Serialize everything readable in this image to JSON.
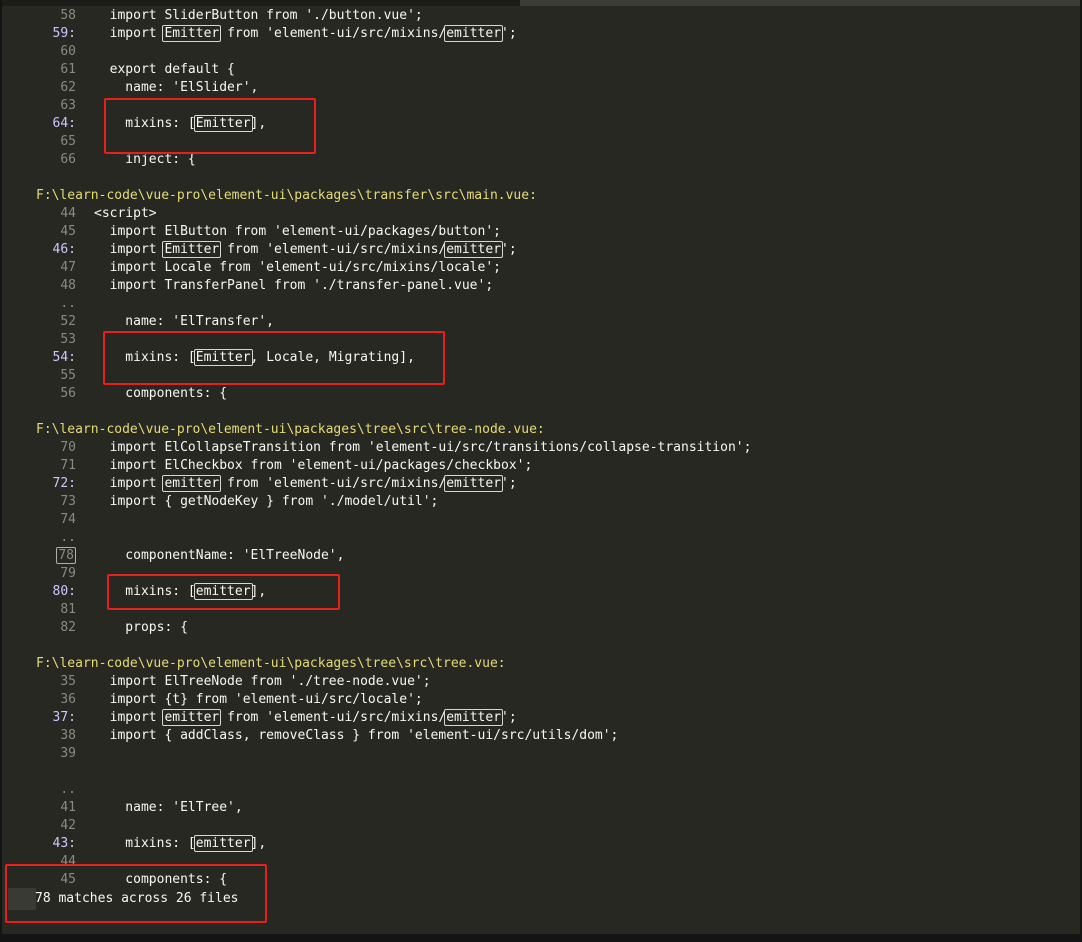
{
  "status": {
    "message": "78 matches across 26 files"
  },
  "colors": {
    "background": "#272822",
    "path": "#e6db74",
    "lineNumber": "#8a8a80",
    "matchLineNumber": "#ccc8ff",
    "annotation": "#e8201c"
  },
  "rows": [
    {
      "type": "line",
      "num": "58",
      "match": false,
      "code": [
        [
          "  import SliderButton from './button.vue';",
          false
        ]
      ]
    },
    {
      "type": "line",
      "num": "59:",
      "match": true,
      "code": [
        [
          "  import ",
          false
        ],
        [
          "Emitter",
          true
        ],
        [
          " from 'element-ui/src/mixins/",
          false
        ],
        [
          "emitter",
          true
        ],
        [
          "';",
          false
        ]
      ]
    },
    {
      "type": "line",
      "num": "60",
      "match": false,
      "code": []
    },
    {
      "type": "line",
      "num": "61",
      "match": false,
      "code": [
        [
          "  export default {",
          false
        ]
      ]
    },
    {
      "type": "line",
      "num": "62",
      "match": false,
      "code": [
        [
          "    name: 'ElSlider',",
          false
        ]
      ]
    },
    {
      "type": "line",
      "num": "63",
      "match": false,
      "code": []
    },
    {
      "type": "line",
      "num": "64:",
      "match": true,
      "code": [
        [
          "    mixins: [",
          false
        ],
        [
          "Emitter",
          true
        ],
        [
          "],",
          false
        ]
      ]
    },
    {
      "type": "line",
      "num": "65",
      "match": false,
      "code": []
    },
    {
      "type": "line",
      "num": "66",
      "match": false,
      "code": [
        [
          "    inject: {",
          false
        ]
      ]
    },
    {
      "type": "blank"
    },
    {
      "type": "path",
      "text": "F:\\learn-code\\vue-pro\\element-ui\\packages\\transfer\\src\\main.vue:"
    },
    {
      "type": "line",
      "num": "44",
      "match": false,
      "code": [
        [
          "<script>",
          false
        ]
      ]
    },
    {
      "type": "line",
      "num": "45",
      "match": false,
      "code": [
        [
          "  import ElButton from 'element-ui/packages/button';",
          false
        ]
      ]
    },
    {
      "type": "line",
      "num": "46:",
      "match": true,
      "code": [
        [
          "  import ",
          false
        ],
        [
          "Emitter",
          true
        ],
        [
          " from 'element-ui/src/mixins/",
          false
        ],
        [
          "emitter",
          true
        ],
        [
          "';",
          false
        ]
      ]
    },
    {
      "type": "line",
      "num": "47",
      "match": false,
      "code": [
        [
          "  import Locale from 'element-ui/src/mixins/locale';",
          false
        ]
      ]
    },
    {
      "type": "line",
      "num": "48",
      "match": false,
      "code": [
        [
          "  import TransferPanel from './transfer-panel.vue';",
          false
        ]
      ]
    },
    {
      "type": "line",
      "num": "..",
      "match": false,
      "code": []
    },
    {
      "type": "line",
      "num": "52",
      "match": false,
      "code": [
        [
          "    name: 'ElTransfer',",
          false
        ]
      ]
    },
    {
      "type": "line",
      "num": "53",
      "match": false,
      "code": []
    },
    {
      "type": "line",
      "num": "54:",
      "match": true,
      "code": [
        [
          "    mixins: [",
          false
        ],
        [
          "Emitter",
          true
        ],
        [
          ", Locale, Migrating],",
          false
        ]
      ]
    },
    {
      "type": "line",
      "num": "55",
      "match": false,
      "code": []
    },
    {
      "type": "line",
      "num": "56",
      "match": false,
      "code": [
        [
          "    components: {",
          false
        ]
      ]
    },
    {
      "type": "blank"
    },
    {
      "type": "path",
      "text": "F:\\learn-code\\vue-pro\\element-ui\\packages\\tree\\src\\tree-node.vue:"
    },
    {
      "type": "line",
      "num": "70",
      "match": false,
      "code": [
        [
          "  import ElCollapseTransition from 'element-ui/src/transitions/collapse-transition';",
          false
        ]
      ]
    },
    {
      "type": "line",
      "num": "71",
      "match": false,
      "code": [
        [
          "  import ElCheckbox from 'element-ui/packages/checkbox';",
          false
        ]
      ]
    },
    {
      "type": "line",
      "num": "72:",
      "match": true,
      "code": [
        [
          "  import ",
          false
        ],
        [
          "emitter",
          true
        ],
        [
          " from 'element-ui/src/mixins/",
          false
        ],
        [
          "emitter",
          true
        ],
        [
          "';",
          false
        ]
      ]
    },
    {
      "type": "line",
      "num": "73",
      "match": false,
      "code": [
        [
          "  import { getNodeKey } from './model/util';",
          false
        ]
      ]
    },
    {
      "type": "line",
      "num": "74",
      "match": false,
      "code": []
    },
    {
      "type": "line",
      "num": "..",
      "match": false,
      "code": []
    },
    {
      "type": "line",
      "num": "78",
      "match": false,
      "boxed": true,
      "code": [
        [
          "    componentName: 'ElTreeNode',",
          false
        ]
      ]
    },
    {
      "type": "line",
      "num": "79",
      "match": false,
      "code": []
    },
    {
      "type": "line",
      "num": "80:",
      "match": true,
      "code": [
        [
          "    mixins: [",
          false
        ],
        [
          "emitter",
          true
        ],
        [
          "],",
          false
        ]
      ]
    },
    {
      "type": "line",
      "num": "81",
      "match": false,
      "code": []
    },
    {
      "type": "line",
      "num": "82",
      "match": false,
      "code": [
        [
          "    props: {",
          false
        ]
      ]
    },
    {
      "type": "blank"
    },
    {
      "type": "path",
      "text": "F:\\learn-code\\vue-pro\\element-ui\\packages\\tree\\src\\tree.vue:"
    },
    {
      "type": "line",
      "num": "35",
      "match": false,
      "code": [
        [
          "  import ElTreeNode from './tree-node.vue';",
          false
        ]
      ]
    },
    {
      "type": "line",
      "num": "36",
      "match": false,
      "code": [
        [
          "  import {t} from 'element-ui/src/locale';",
          false
        ]
      ]
    },
    {
      "type": "line",
      "num": "37:",
      "match": true,
      "code": [
        [
          "  import ",
          false
        ],
        [
          "emitter",
          true
        ],
        [
          " from 'element-ui/src/mixins/",
          false
        ],
        [
          "emitter",
          true
        ],
        [
          "';",
          false
        ]
      ]
    },
    {
      "type": "line",
      "num": "38",
      "match": false,
      "code": [
        [
          "  import { addClass, removeClass } from 'element-ui/src/utils/dom';",
          false
        ]
      ]
    },
    {
      "type": "line",
      "num": "39",
      "match": false,
      "code": []
    },
    {
      "type": "blank"
    },
    {
      "type": "line",
      "num": "..",
      "match": false,
      "code": []
    },
    {
      "type": "line",
      "num": "41",
      "match": false,
      "code": [
        [
          "    name: 'ElTree',",
          false
        ]
      ]
    },
    {
      "type": "line",
      "num": "42",
      "match": false,
      "code": []
    },
    {
      "type": "line",
      "num": "43:",
      "match": true,
      "code": [
        [
          "    mixins: [",
          false
        ],
        [
          "emitter",
          true
        ],
        [
          "],",
          false
        ]
      ]
    },
    {
      "type": "line",
      "num": "44",
      "match": false,
      "code": []
    },
    {
      "type": "line",
      "num": "45",
      "match": false,
      "code": [
        [
          "    components: {",
          false
        ]
      ]
    }
  ]
}
